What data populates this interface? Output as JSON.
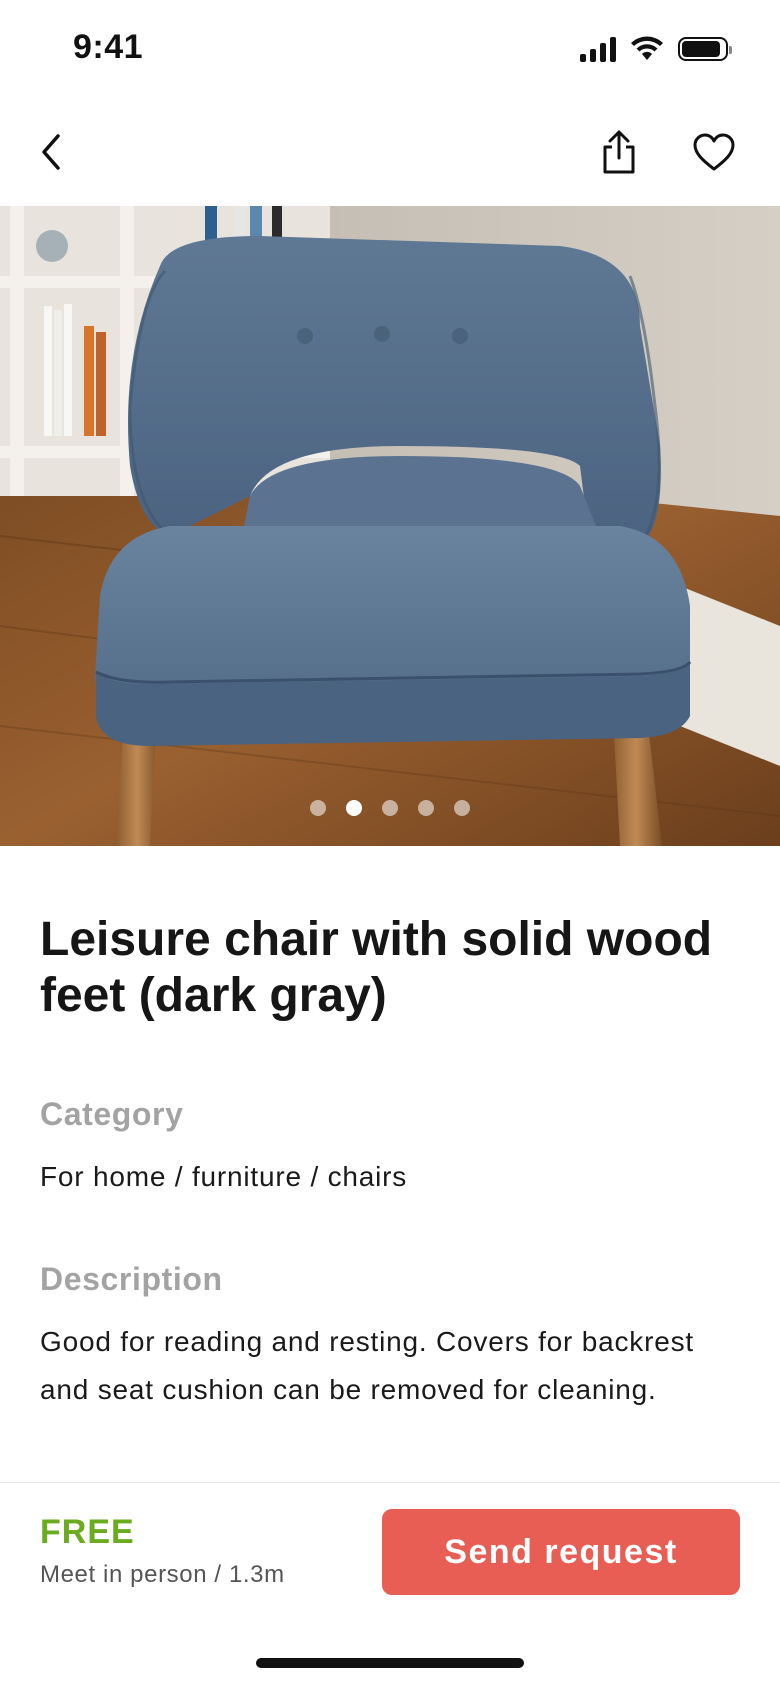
{
  "status_bar": {
    "time": "9:41",
    "battery_level": 0.9
  },
  "nav": {
    "back_icon": "chevron-left-icon",
    "share_icon": "share-icon",
    "favorite_icon": "heart-icon"
  },
  "gallery": {
    "image": "blue-upholstered-armchair-photo",
    "total_images": 5,
    "active_index": 1
  },
  "product": {
    "title": "Leisure chair with solid wood feet (dark gray)",
    "category_label": "Category",
    "category_value": "For home / furniture / chairs",
    "description_label": "Description",
    "description_value": "Good for reading and resting. Covers for backrest and seat cushion can be removed for cleaning."
  },
  "footer": {
    "price": "FREE",
    "pickup": "Meet in person / 1.3m",
    "cta_label": "Send request"
  },
  "colors": {
    "accent": "#e85d54",
    "price_green": "#6aab1f",
    "muted_label": "#a3a3a3"
  }
}
